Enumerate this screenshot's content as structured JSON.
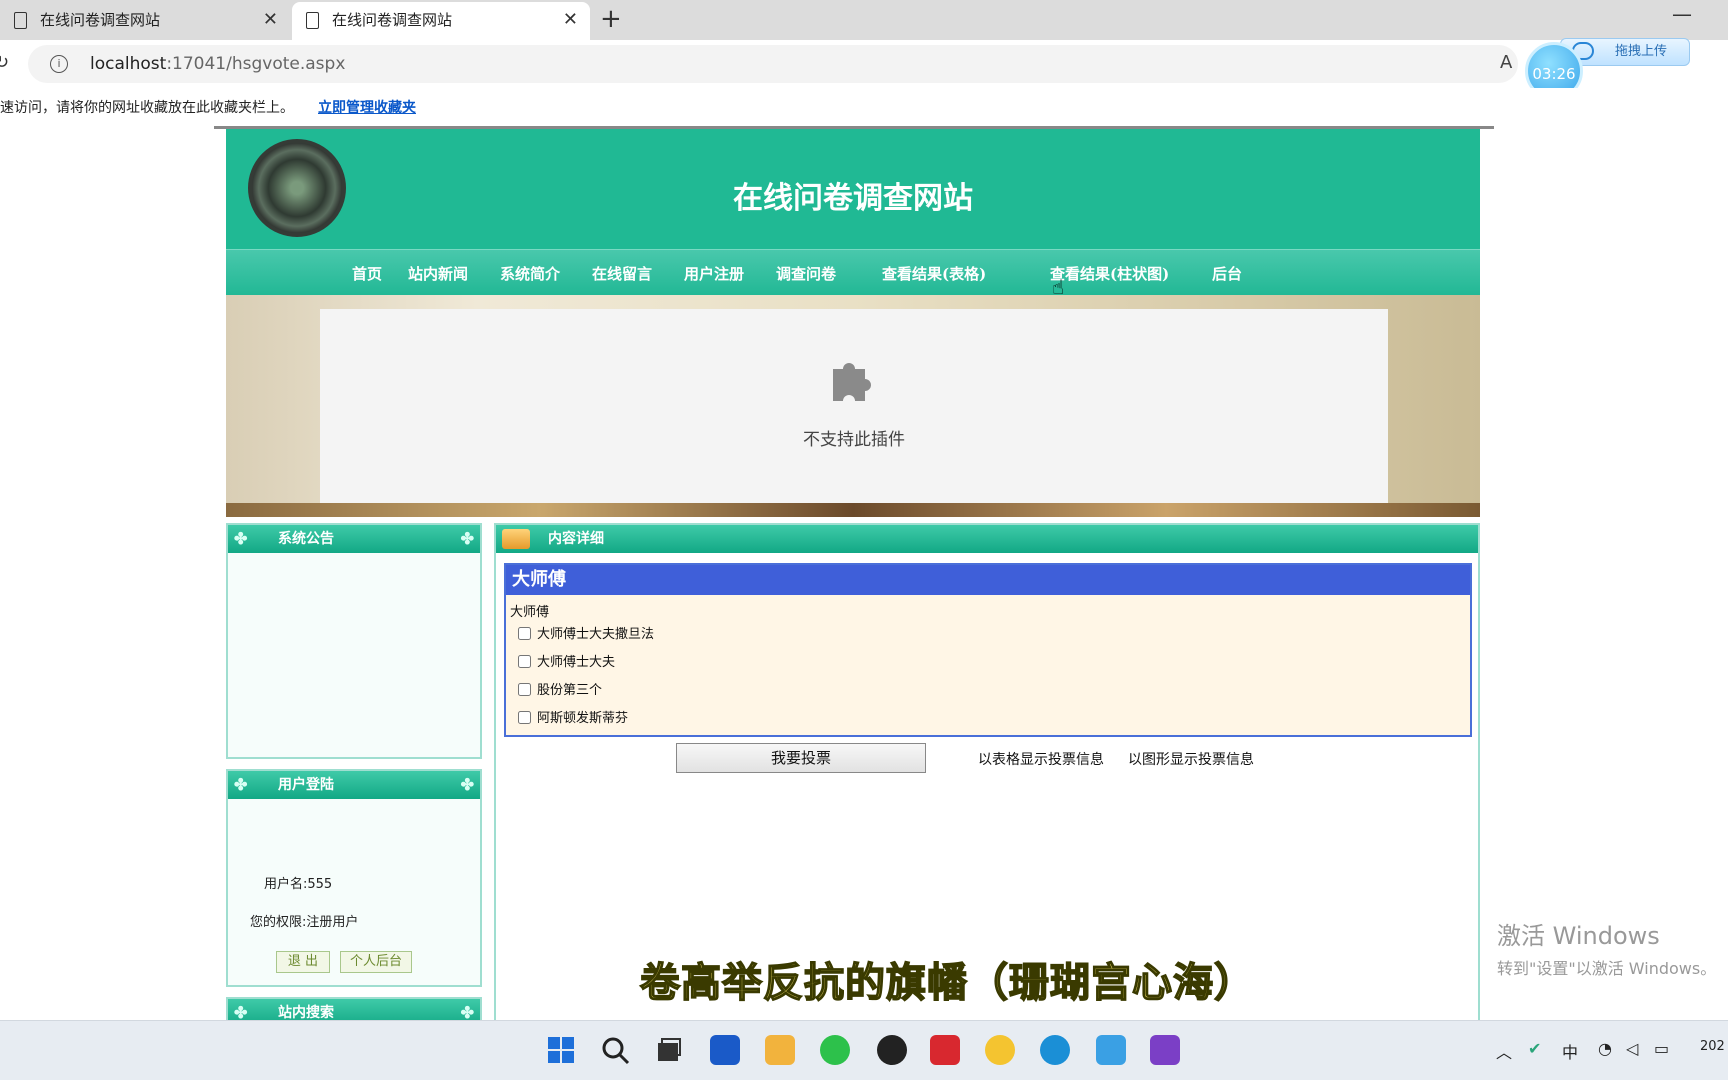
{
  "browser": {
    "tabs": [
      {
        "title": "在线问卷调查网站",
        "active": false
      },
      {
        "title": "在线问卷调查网站",
        "active": true
      }
    ],
    "url_host": "localhost",
    "url_rest": ":17041/hsgvote.aspx",
    "timer": "03:26",
    "upload_label": "拖拽上传",
    "fav_message": "速访问，请将你的网址收藏放在此收藏夹栏上。",
    "fav_link": "立即管理收藏夹"
  },
  "site": {
    "title": "在线问卷调查网站",
    "nav": [
      "首页",
      "站内新闻",
      "系统简介",
      "在线留言",
      "用户注册",
      "调查问卷",
      "查看结果(表格)",
      "查看结果(柱状图)",
      "后台"
    ]
  },
  "plugin": {
    "message": "不支持此插件"
  },
  "sidebar": {
    "notice_title": "系统公告",
    "login_title": "用户登陆",
    "username_line": "用户名:555",
    "role_line": "您的权限:注册用户",
    "logout_label": "退 出",
    "personal_label": "个人后台",
    "search_title": "站内搜索"
  },
  "content": {
    "header": "内容详细",
    "vote_title": "大师傅",
    "vote_subtitle": "大师傅",
    "options": [
      "大师傅士大夫撒旦法",
      "大师傅士大夫",
      "股份第三个",
      "阿斯顿发斯蒂芬"
    ],
    "vote_button": "我要投票",
    "table_link": "以表格显示投票信息",
    "chart_link": "以图形显示投票信息"
  },
  "overlay": {
    "subtitle": "卷高举反抗的旗幡（珊瑚宫心海）"
  },
  "watermark": {
    "line1": "激活 Windows",
    "line2": "转到\"设置\"以激活 Windows。"
  },
  "taskbar": {
    "ime": "中",
    "clock": "202"
  }
}
